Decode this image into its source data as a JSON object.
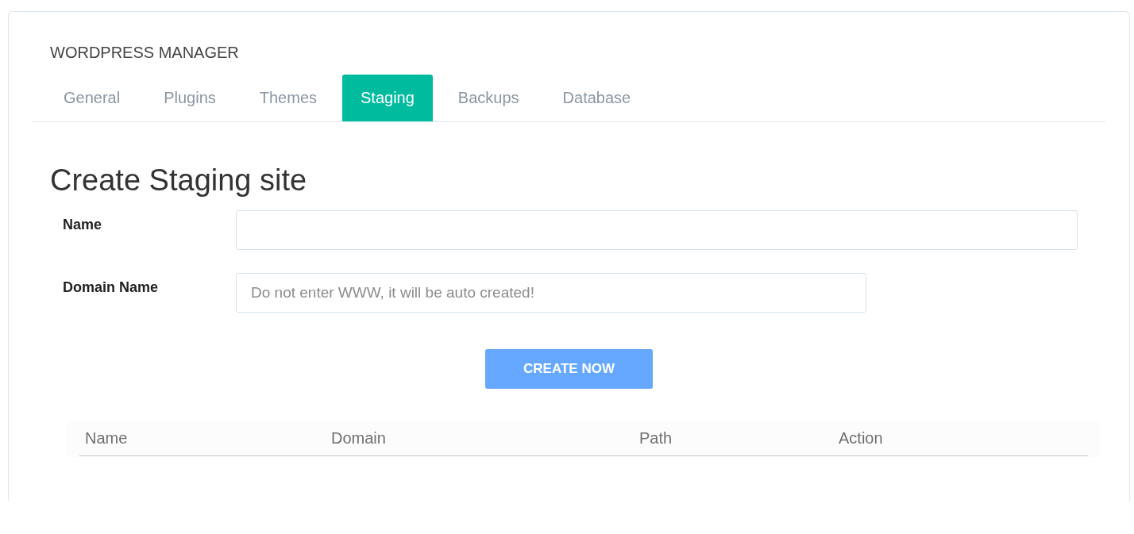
{
  "header": {
    "title": "WORDPRESS MANAGER"
  },
  "tabs": [
    {
      "label": "General",
      "selected": false
    },
    {
      "label": "Plugins",
      "selected": false
    },
    {
      "label": "Themes",
      "selected": false
    },
    {
      "label": "Staging",
      "selected": true
    },
    {
      "label": "Backups",
      "selected": false
    },
    {
      "label": "Database",
      "selected": false
    }
  ],
  "form": {
    "heading": "Create Staging site",
    "fields": [
      {
        "label": "Name"
      },
      {
        "label": "Domain Name",
        "placeholder": "Do not enter WWW, it will be auto created!"
      }
    ],
    "submit": "CREATE NOW"
  },
  "table": {
    "columns": [
      "Name",
      "Domain",
      "Path",
      "Action"
    ]
  }
}
